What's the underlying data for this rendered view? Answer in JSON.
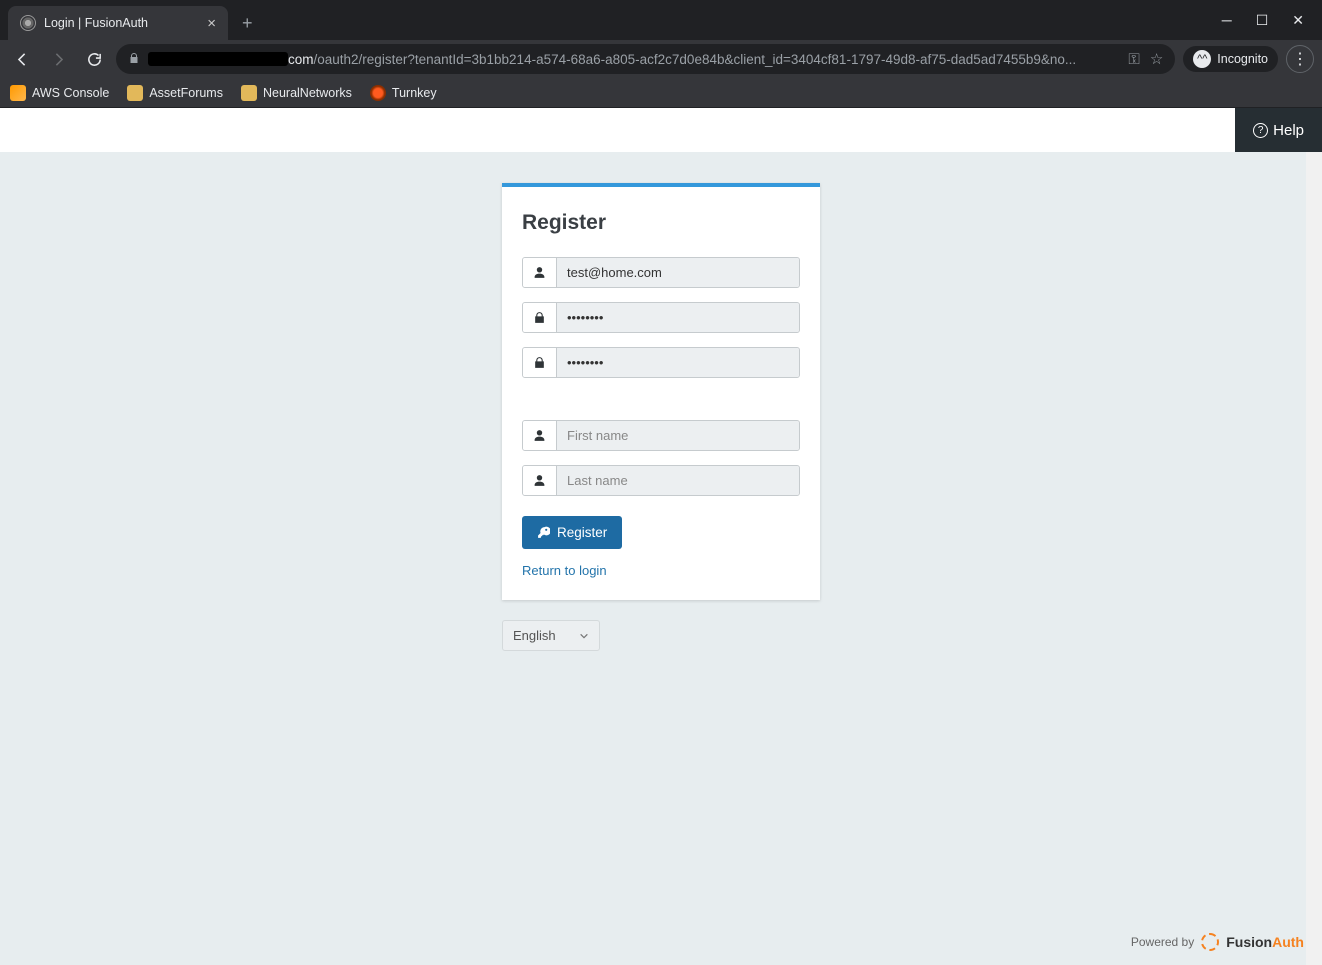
{
  "browser": {
    "tab_title": "Login | FusionAuth",
    "url_domain_visible": "com",
    "url_path": "/oauth2/register?tenantId=3b1bb214-a574-68a6-a805-acf2c7d0e84b&client_id=3404cf81-1797-49d8-af75-dad5ad7455b9&no...",
    "incognito_label": "Incognito",
    "bookmarks": [
      {
        "label": "AWS Console"
      },
      {
        "label": "AssetForums"
      },
      {
        "label": "NeuralNetworks"
      },
      {
        "label": "Turnkey"
      }
    ]
  },
  "page": {
    "help_label": "Help",
    "card_heading": "Register",
    "fields": {
      "email_value": "test@home.com",
      "password_value": "••••••••",
      "confirm_value": "••••••••",
      "firstname_placeholder": "First name",
      "lastname_placeholder": "Last name"
    },
    "register_button": "Register",
    "return_link": "Return to login",
    "language_selected": "English",
    "powered_by_label": "Powered by",
    "brand_first": "Fusion",
    "brand_second": "Auth"
  }
}
